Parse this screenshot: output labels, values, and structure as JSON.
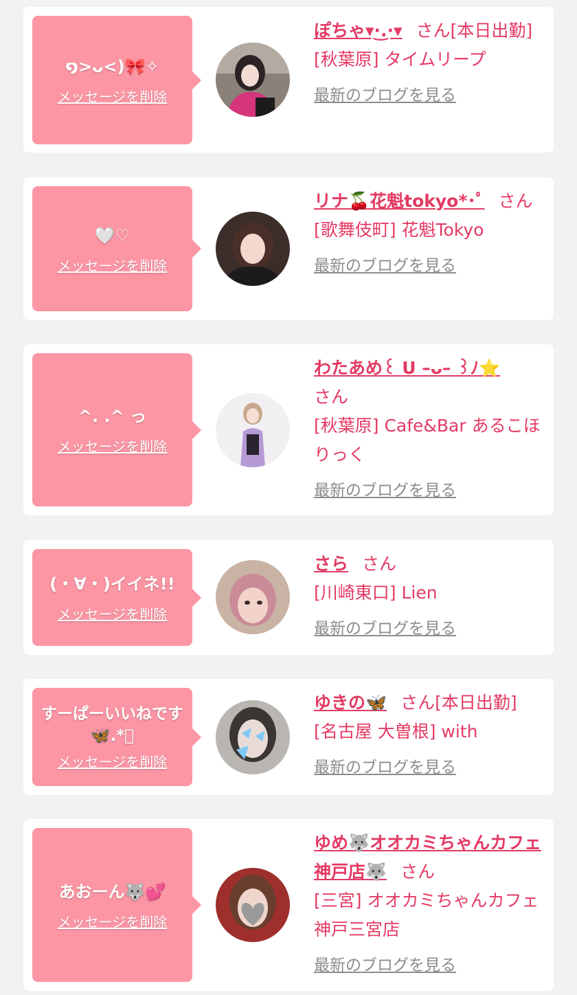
{
  "colors": {
    "background": "#f2f2f2",
    "card": "#ffffff",
    "bubble": "#fc96a4",
    "accent_text": "#e33a63",
    "muted_link": "#8c8c8c"
  },
  "labels": {
    "delete": "メッセージを削除",
    "blog": "最新のブログを見る",
    "honorific": "さん"
  },
  "items": [
    {
      "message": "໑>ᴗ<)🎀✧",
      "name": "ぽちゃ▾·͜.·▾",
      "suffix": "[本日出勤]",
      "shop": "[秋葉原] タイムリープ",
      "avatar_icon": "photo-avatar-1"
    },
    {
      "message": "🤍♡",
      "name": "リナ🍒花魁tokyo*･ﾟ",
      "suffix": "",
      "shop": "[歌舞伎町] 花魁Tokyo",
      "avatar_icon": "photo-avatar-2"
    },
    {
      "message": "^. .^ っ",
      "name": "わたあめ꒰ U –ᴗ– ꒱ﾉ⭐️",
      "suffix": "",
      "shop": "[秋葉原] Cafe&Bar あるこほりっく",
      "avatar_icon": "photo-avatar-3"
    },
    {
      "message": "(・∀・)イイネ!!",
      "name": "さら",
      "suffix": "",
      "shop": "[川崎東口] Lien",
      "avatar_icon": "photo-avatar-4"
    },
    {
      "message": "すーぱーいいねです🦋.*ﾟ",
      "name": "ゆきの🦋",
      "suffix": "[本日出勤]",
      "shop": "[名古屋 大曽根] with",
      "avatar_icon": "photo-avatar-5"
    },
    {
      "message": "あおーん🐺💕",
      "name": "ゆめ🐺オオカミちゃんカフェ神戸店🐺",
      "suffix": "",
      "shop": "[三宮] オオカミちゃんカフェ神戸三宮店",
      "avatar_icon": "photo-avatar-6"
    }
  ]
}
